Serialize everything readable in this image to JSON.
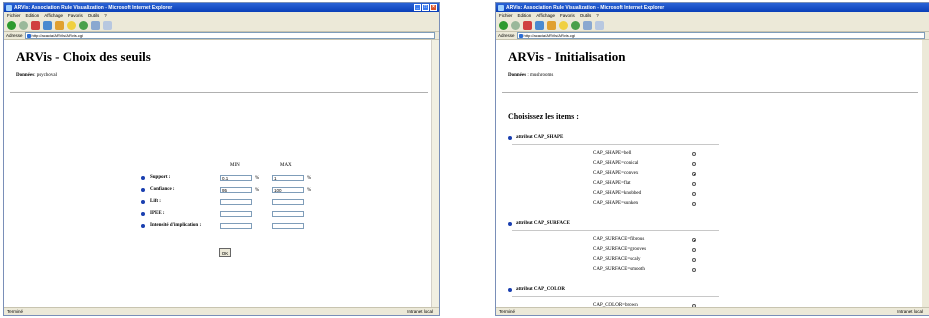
{
  "window1": {
    "title": "ARVis: Association Rule Visualization - Microsoft Internet Explorer",
    "menu": [
      "Fichier",
      "Edition",
      "Affichage",
      "Favoris",
      "Outils",
      "?"
    ],
    "address_label": "Adresse",
    "address": "http://acacia/ARVis/ARvis.cgi",
    "heading": "ARVis - Choix des seuils",
    "data_label": "Données",
    "data_value": "psychoval",
    "col_min": "MIN",
    "col_max": "MAX",
    "rows": [
      {
        "label": "Support :",
        "min": "0.1",
        "max": "1",
        "min_unit": "%",
        "max_unit": "%"
      },
      {
        "label": "Confiance :",
        "min": "95",
        "max": "100",
        "min_unit": "%",
        "max_unit": "%"
      },
      {
        "label": "Lift :",
        "min": "",
        "max": "",
        "min_unit": "",
        "max_unit": ""
      },
      {
        "label": "IPEE :",
        "min": "",
        "max": "",
        "min_unit": "",
        "max_unit": ""
      },
      {
        "label": "Intensité d'implication :",
        "min": "",
        "max": "",
        "min_unit": "",
        "max_unit": ""
      }
    ],
    "ok_label": "OK",
    "status": "Terminé",
    "zone": "Intranet local"
  },
  "window2": {
    "title": "ARVis: Association Rule Visualization - Microsoft Internet Explorer",
    "menu": [
      "Fichier",
      "Edition",
      "Affichage",
      "Favoris",
      "Outils",
      "?"
    ],
    "address_label": "Adresse",
    "address": "http://acacia/ARVis/ARvis.cgi",
    "heading": "ARVis - Initialisation",
    "data_label": "Données",
    "data_value": "mushrooms",
    "choose_label": "Choisissez les items :",
    "attributes": [
      {
        "label": "attribut CAP_SHAPE",
        "items": [
          {
            "label": "CAP_SHAPE=bell",
            "selected": false
          },
          {
            "label": "CAP_SHAPE=conical",
            "selected": false
          },
          {
            "label": "CAP_SHAPE=convex",
            "selected": true
          },
          {
            "label": "CAP_SHAPE=flat",
            "selected": false
          },
          {
            "label": "CAP_SHAPE=knobbed",
            "selected": false
          },
          {
            "label": "CAP_SHAPE=sunken",
            "selected": false
          }
        ]
      },
      {
        "label": "attribut CAP_SURFACE",
        "items": [
          {
            "label": "CAP_SURFACE=fibrous",
            "selected": true
          },
          {
            "label": "CAP_SURFACE=grooves",
            "selected": false
          },
          {
            "label": "CAP_SURFACE=scaly",
            "selected": false
          },
          {
            "label": "CAP_SURFACE=smooth",
            "selected": false
          }
        ]
      },
      {
        "label": "attribut CAP_COLOR",
        "items": [
          {
            "label": "CAP_COLOR=brown",
            "selected": false
          }
        ]
      }
    ],
    "status": "Terminé",
    "zone": "Intranet local"
  }
}
